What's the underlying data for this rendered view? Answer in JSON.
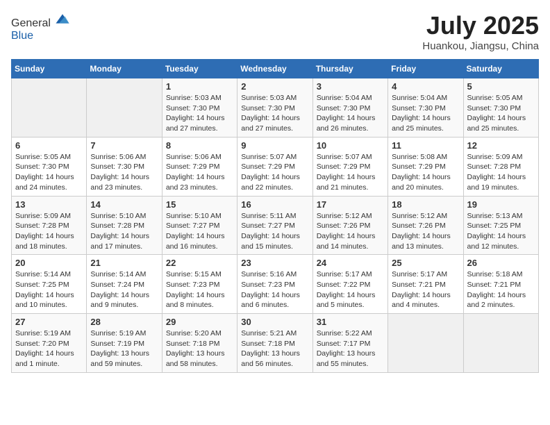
{
  "header": {
    "logo_general": "General",
    "logo_blue": "Blue",
    "month_title": "July 2025",
    "location": "Huankou, Jiangsu, China"
  },
  "days_of_week": [
    "Sunday",
    "Monday",
    "Tuesday",
    "Wednesday",
    "Thursday",
    "Friday",
    "Saturday"
  ],
  "weeks": [
    [
      {
        "day": "",
        "empty": true
      },
      {
        "day": "",
        "empty": true
      },
      {
        "day": "1",
        "sunrise": "Sunrise: 5:03 AM",
        "sunset": "Sunset: 7:30 PM",
        "daylight": "Daylight: 14 hours and 27 minutes."
      },
      {
        "day": "2",
        "sunrise": "Sunrise: 5:03 AM",
        "sunset": "Sunset: 7:30 PM",
        "daylight": "Daylight: 14 hours and 27 minutes."
      },
      {
        "day": "3",
        "sunrise": "Sunrise: 5:04 AM",
        "sunset": "Sunset: 7:30 PM",
        "daylight": "Daylight: 14 hours and 26 minutes."
      },
      {
        "day": "4",
        "sunrise": "Sunrise: 5:04 AM",
        "sunset": "Sunset: 7:30 PM",
        "daylight": "Daylight: 14 hours and 25 minutes."
      },
      {
        "day": "5",
        "sunrise": "Sunrise: 5:05 AM",
        "sunset": "Sunset: 7:30 PM",
        "daylight": "Daylight: 14 hours and 25 minutes."
      }
    ],
    [
      {
        "day": "6",
        "sunrise": "Sunrise: 5:05 AM",
        "sunset": "Sunset: 7:30 PM",
        "daylight": "Daylight: 14 hours and 24 minutes."
      },
      {
        "day": "7",
        "sunrise": "Sunrise: 5:06 AM",
        "sunset": "Sunset: 7:30 PM",
        "daylight": "Daylight: 14 hours and 23 minutes."
      },
      {
        "day": "8",
        "sunrise": "Sunrise: 5:06 AM",
        "sunset": "Sunset: 7:29 PM",
        "daylight": "Daylight: 14 hours and 23 minutes."
      },
      {
        "day": "9",
        "sunrise": "Sunrise: 5:07 AM",
        "sunset": "Sunset: 7:29 PM",
        "daylight": "Daylight: 14 hours and 22 minutes."
      },
      {
        "day": "10",
        "sunrise": "Sunrise: 5:07 AM",
        "sunset": "Sunset: 7:29 PM",
        "daylight": "Daylight: 14 hours and 21 minutes."
      },
      {
        "day": "11",
        "sunrise": "Sunrise: 5:08 AM",
        "sunset": "Sunset: 7:29 PM",
        "daylight": "Daylight: 14 hours and 20 minutes."
      },
      {
        "day": "12",
        "sunrise": "Sunrise: 5:09 AM",
        "sunset": "Sunset: 7:28 PM",
        "daylight": "Daylight: 14 hours and 19 minutes."
      }
    ],
    [
      {
        "day": "13",
        "sunrise": "Sunrise: 5:09 AM",
        "sunset": "Sunset: 7:28 PM",
        "daylight": "Daylight: 14 hours and 18 minutes."
      },
      {
        "day": "14",
        "sunrise": "Sunrise: 5:10 AM",
        "sunset": "Sunset: 7:28 PM",
        "daylight": "Daylight: 14 hours and 17 minutes."
      },
      {
        "day": "15",
        "sunrise": "Sunrise: 5:10 AM",
        "sunset": "Sunset: 7:27 PM",
        "daylight": "Daylight: 14 hours and 16 minutes."
      },
      {
        "day": "16",
        "sunrise": "Sunrise: 5:11 AM",
        "sunset": "Sunset: 7:27 PM",
        "daylight": "Daylight: 14 hours and 15 minutes."
      },
      {
        "day": "17",
        "sunrise": "Sunrise: 5:12 AM",
        "sunset": "Sunset: 7:26 PM",
        "daylight": "Daylight: 14 hours and 14 minutes."
      },
      {
        "day": "18",
        "sunrise": "Sunrise: 5:12 AM",
        "sunset": "Sunset: 7:26 PM",
        "daylight": "Daylight: 14 hours and 13 minutes."
      },
      {
        "day": "19",
        "sunrise": "Sunrise: 5:13 AM",
        "sunset": "Sunset: 7:25 PM",
        "daylight": "Daylight: 14 hours and 12 minutes."
      }
    ],
    [
      {
        "day": "20",
        "sunrise": "Sunrise: 5:14 AM",
        "sunset": "Sunset: 7:25 PM",
        "daylight": "Daylight: 14 hours and 10 minutes."
      },
      {
        "day": "21",
        "sunrise": "Sunrise: 5:14 AM",
        "sunset": "Sunset: 7:24 PM",
        "daylight": "Daylight: 14 hours and 9 minutes."
      },
      {
        "day": "22",
        "sunrise": "Sunrise: 5:15 AM",
        "sunset": "Sunset: 7:23 PM",
        "daylight": "Daylight: 14 hours and 8 minutes."
      },
      {
        "day": "23",
        "sunrise": "Sunrise: 5:16 AM",
        "sunset": "Sunset: 7:23 PM",
        "daylight": "Daylight: 14 hours and 6 minutes."
      },
      {
        "day": "24",
        "sunrise": "Sunrise: 5:17 AM",
        "sunset": "Sunset: 7:22 PM",
        "daylight": "Daylight: 14 hours and 5 minutes."
      },
      {
        "day": "25",
        "sunrise": "Sunrise: 5:17 AM",
        "sunset": "Sunset: 7:21 PM",
        "daylight": "Daylight: 14 hours and 4 minutes."
      },
      {
        "day": "26",
        "sunrise": "Sunrise: 5:18 AM",
        "sunset": "Sunset: 7:21 PM",
        "daylight": "Daylight: 14 hours and 2 minutes."
      }
    ],
    [
      {
        "day": "27",
        "sunrise": "Sunrise: 5:19 AM",
        "sunset": "Sunset: 7:20 PM",
        "daylight": "Daylight: 14 hours and 1 minute."
      },
      {
        "day": "28",
        "sunrise": "Sunrise: 5:19 AM",
        "sunset": "Sunset: 7:19 PM",
        "daylight": "Daylight: 13 hours and 59 minutes."
      },
      {
        "day": "29",
        "sunrise": "Sunrise: 5:20 AM",
        "sunset": "Sunset: 7:18 PM",
        "daylight": "Daylight: 13 hours and 58 minutes."
      },
      {
        "day": "30",
        "sunrise": "Sunrise: 5:21 AM",
        "sunset": "Sunset: 7:18 PM",
        "daylight": "Daylight: 13 hours and 56 minutes."
      },
      {
        "day": "31",
        "sunrise": "Sunrise: 5:22 AM",
        "sunset": "Sunset: 7:17 PM",
        "daylight": "Daylight: 13 hours and 55 minutes."
      },
      {
        "day": "",
        "empty": true
      },
      {
        "day": "",
        "empty": true
      }
    ]
  ]
}
